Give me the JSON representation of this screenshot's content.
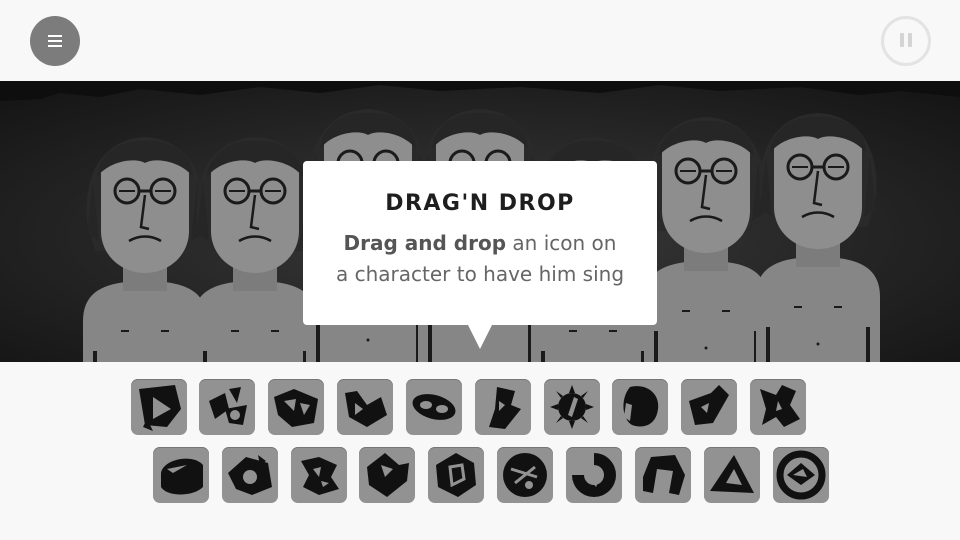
{
  "header": {
    "menu_icon": "menu-icon",
    "pause_icon": "pause-icon"
  },
  "tooltip": {
    "title": "DRAG'N DROP",
    "body_strong": "Drag and drop",
    "body_rest_line1": " an icon on",
    "body_line2": "a character to have him sing"
  },
  "colors": {
    "stage_background": "#1c1c1c",
    "character_fill": "#8a8a8a",
    "icon_background": "#929292",
    "icon_shape": "#111111",
    "menu_button": "#7c7c7c"
  },
  "tray": {
    "row1": [
      "sound-icon-1",
      "sound-icon-2",
      "sound-icon-3",
      "sound-icon-4",
      "sound-icon-5",
      "sound-icon-6",
      "sound-icon-7",
      "sound-icon-8",
      "sound-icon-9",
      "sound-icon-10"
    ],
    "row2": [
      "sound-icon-11",
      "sound-icon-12",
      "sound-icon-13",
      "sound-icon-14",
      "sound-icon-15",
      "sound-icon-16",
      "sound-icon-17",
      "sound-icon-18",
      "sound-icon-19",
      "sound-icon-20"
    ]
  }
}
